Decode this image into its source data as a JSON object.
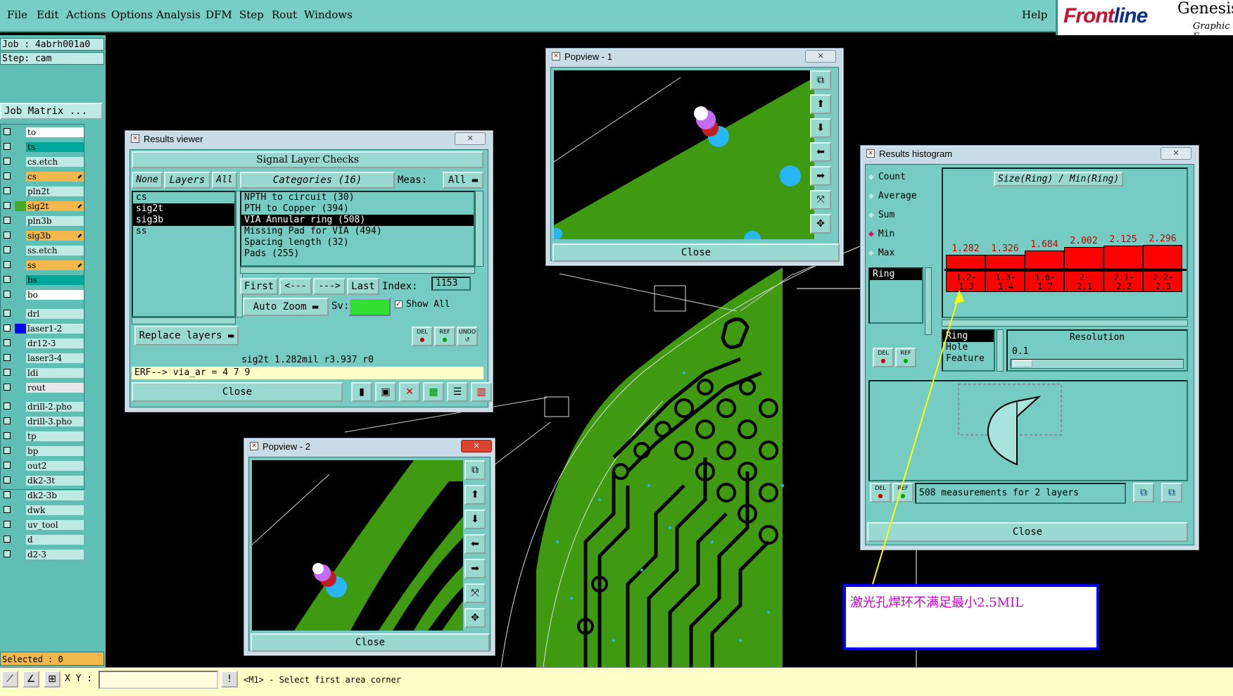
{
  "menubar": {
    "items": [
      "File",
      "Edit",
      "Actions",
      "Options",
      "Analysis",
      "DFM",
      "Step",
      "Rout",
      "Windows"
    ],
    "help": "Help"
  },
  "brand": {
    "logo_a": "Front",
    "logo_b": "line",
    "product": "Genesis",
    "subtitle": "Graphic E"
  },
  "jobinfo": {
    "job": "Job : 4abrh001a0",
    "step": "Step: cam",
    "matrix_btn": "Job Matrix ..."
  },
  "layers": [
    {
      "name": "to",
      "bg": "#ffffff",
      "checked": false
    },
    {
      "name": "ts",
      "bg": "#00a89c",
      "checked": false
    },
    {
      "name": "cs.etch",
      "bg": "#bfe9e4",
      "checked": false
    },
    {
      "name": "cs",
      "bg": "#f3b84c",
      "checked": false,
      "arrow": true
    },
    {
      "name": "pln2t",
      "bg": "#bfe9e4",
      "checked": false
    },
    {
      "name": "sig2t",
      "bg": "#f3b84c",
      "checked": false,
      "arrow": true,
      "color": "#44aa22"
    },
    {
      "name": "pln3b",
      "bg": "#bfe9e4",
      "checked": false
    },
    {
      "name": "sig3b",
      "bg": "#f3b84c",
      "checked": false,
      "arrow": true
    },
    {
      "name": "ss.etch",
      "bg": "#bfe9e4",
      "checked": false
    },
    {
      "name": "ss",
      "bg": "#f3b84c",
      "checked": false,
      "arrow": true
    },
    {
      "name": "bs",
      "bg": "#00a89c",
      "checked": false
    },
    {
      "name": "bo",
      "bg": "#ffffff",
      "checked": false
    },
    {
      "name": "drl",
      "bg": "#bfe9e4",
      "checked": false
    },
    {
      "name": "laser1-2",
      "bg": "#bfe9e4",
      "checked": true,
      "color": "#0000ff"
    },
    {
      "name": "dr12-3",
      "bg": "#bfe9e4",
      "checked": false
    },
    {
      "name": "laser3-4",
      "bg": "#bfe9e4",
      "checked": false
    },
    {
      "name": "ldi",
      "bg": "#bfe9e4",
      "checked": false
    },
    {
      "name": "rout",
      "bg": "#e8e8e8",
      "checked": false
    },
    {
      "name": "drill-2.pho",
      "bg": "#bfe9e4",
      "checked": false
    },
    {
      "name": "drill-3.pho",
      "bg": "#bfe9e4",
      "checked": false
    },
    {
      "name": "tp",
      "bg": "#bfe9e4",
      "checked": false
    },
    {
      "name": "bp",
      "bg": "#bfe9e4",
      "checked": false
    },
    {
      "name": "out2",
      "bg": "#bfe9e4",
      "checked": false
    },
    {
      "name": "dk2-3t",
      "bg": "#bfe9e4",
      "checked": false
    },
    {
      "name": "dk2-3b",
      "bg": "#bfe9e4",
      "checked": false
    },
    {
      "name": "dwk",
      "bg": "#bfe9e4",
      "checked": false
    },
    {
      "name": "uv_tool",
      "bg": "#bfe9e4",
      "checked": false
    },
    {
      "name": "d",
      "bg": "#bfe9e4",
      "checked": false
    },
    {
      "name": "d2-3",
      "bg": "#bfe9e4",
      "checked": false
    }
  ],
  "selected": "Selected : 0",
  "bottombar": {
    "xy_label": "X Y :",
    "message": "<M1> - Select first area corner"
  },
  "results_viewer": {
    "title": "Results viewer",
    "header": "Signal Layer Checks",
    "none_btn": "None",
    "layers_lbl": "Layers",
    "all_btn": "All",
    "categories_lbl": "Categories (16)",
    "meas_lbl": "Meas:",
    "meas_val": "All",
    "layer_items": [
      "cs",
      "sig2t",
      "sig3b",
      "ss"
    ],
    "category_items": [
      "NPTH to circuit (30)",
      "PTH to Copper (394)",
      "VIA Annular ring (508)",
      "Missing Pad for VIA (494)",
      "Spacing length (32)",
      "Pads (255)"
    ],
    "first_btn": "First",
    "prev_btn": "<---",
    "next_btn": "--->",
    "last_btn": "Last",
    "index_lbl": "Index:",
    "index_val": "1153",
    "autozoom_btn": "Auto Zoom",
    "sv_lbl": "Sv:",
    "showall_lbl": "Show All",
    "replace_btn": "Replace layers",
    "del_lbl": "DEL",
    "ref_lbl": "REF",
    "undo_lbl": "UNDO",
    "status": "sig2t 1.282mil  r3.937  r0",
    "erf": "ERF--> via_ar = 4 7 9",
    "close": "Close"
  },
  "popview1": {
    "title": "Popview - 1",
    "close": "Close"
  },
  "popview2": {
    "title": "Popview - 2",
    "close": "Close"
  },
  "histogram": {
    "title": "Results histogram",
    "options": [
      "Count",
      "Average",
      "Sum",
      "Min",
      "Max"
    ],
    "selected_option": "Min",
    "graph_title": "Size(Ring) / Min(Ring)",
    "list_item": "Ring",
    "bars": [
      {
        "value": "1.282",
        "cat1": "1.2-",
        "cat2": "1.3",
        "level": 0.58
      },
      {
        "value": "1.326",
        "cat1": "1.3-",
        "cat2": "1.4",
        "level": 0.6
      },
      {
        "value": "1.684",
        "cat1": "1.6-",
        "cat2": "1.7",
        "level": 0.76
      },
      {
        "value": "2.002",
        "cat1": "2-",
        "cat2": "2.1",
        "level": 0.9
      },
      {
        "value": "2.125",
        "cat1": "2.1-",
        "cat2": "2.2",
        "level": 0.96
      },
      {
        "value": "2.296",
        "cat1": "2.2-",
        "cat2": "2.3",
        "level": 1.0
      }
    ],
    "type_items": [
      "Ring",
      "Hole",
      "Feature"
    ],
    "resolution_lbl": "Resolution",
    "resolution_val": "0.1",
    "del_lbl": "DEL",
    "ref_lbl": "REF",
    "measurements": "508 measurements for 2 layers",
    "close": "Close"
  },
  "annotation": "激光孔焊环不满足最小2.5MIL",
  "colors": {
    "ui_teal": "#76cbc2",
    "board_green": "#3f9a12",
    "highlight": "#f3b84c"
  }
}
